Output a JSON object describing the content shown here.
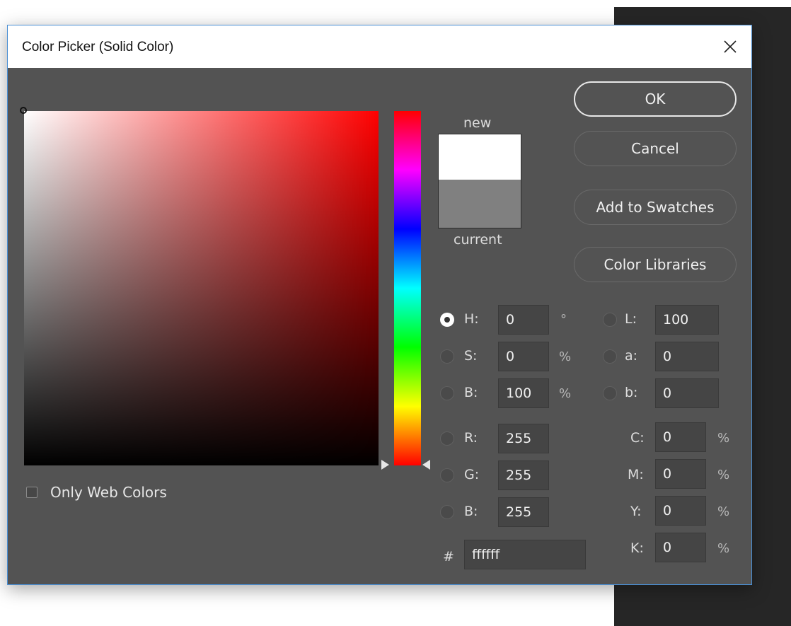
{
  "window": {
    "title": "Color Picker (Solid Color)",
    "close_glyph": "×"
  },
  "colors": {
    "dialog_bg": "#535353",
    "field_hue": "#ff0000",
    "new_swatch": "#ffffff",
    "current_swatch": "#808080"
  },
  "swatch": {
    "new_label": "new",
    "current_label": "current"
  },
  "buttons": {
    "ok": "OK",
    "cancel": "Cancel",
    "add_to_swatches": "Add to Swatches",
    "color_libraries": "Color Libraries"
  },
  "only_web_colors": {
    "label": "Only Web Colors",
    "checked": false
  },
  "hsb": {
    "h": {
      "label": "H:",
      "value": "0",
      "unit": "°",
      "selected": true
    },
    "s": {
      "label": "S:",
      "value": "0",
      "unit": "%"
    },
    "b": {
      "label": "B:",
      "value": "100",
      "unit": "%"
    }
  },
  "rgb": {
    "r": {
      "label": "R:",
      "value": "255"
    },
    "g": {
      "label": "G:",
      "value": "255"
    },
    "b": {
      "label": "B:",
      "value": "255"
    }
  },
  "lab": {
    "l": {
      "label": "L:",
      "value": "100"
    },
    "a": {
      "label": "a:",
      "value": "0"
    },
    "b": {
      "label": "b:",
      "value": "0"
    }
  },
  "cmyk": {
    "c": {
      "label": "C:",
      "value": "0",
      "unit": "%"
    },
    "m": {
      "label": "M:",
      "value": "0",
      "unit": "%"
    },
    "y": {
      "label": "Y:",
      "value": "0",
      "unit": "%"
    },
    "k": {
      "label": "K:",
      "value": "0",
      "unit": "%"
    }
  },
  "hex": {
    "prefix": "#",
    "value": "ffffff"
  }
}
